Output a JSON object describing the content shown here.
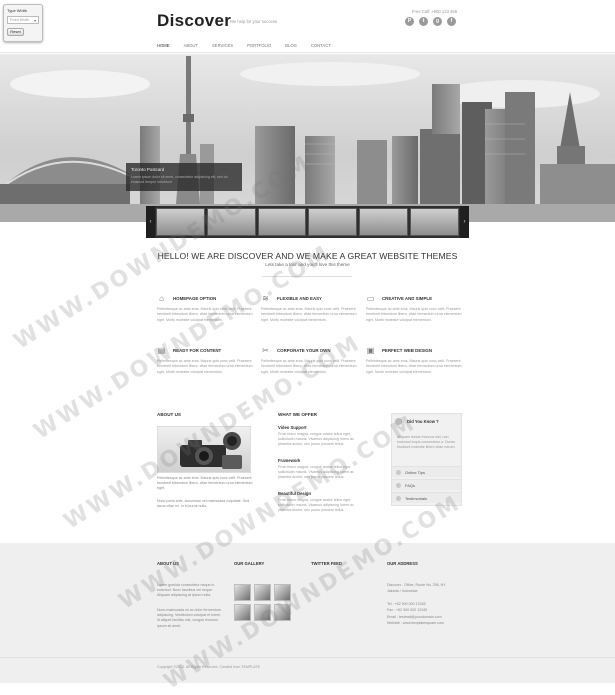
{
  "type_width": {
    "label": "Type Width",
    "select_value": "Fixed Width",
    "reset": "Reset"
  },
  "header": {
    "logo": "Discover",
    "tagline": "We help for your success",
    "free_call": "Free Call: +900 123 456",
    "social": [
      {
        "icon": "pinterest-icon",
        "glyph": "P"
      },
      {
        "icon": "twitter-icon",
        "glyph": "t"
      },
      {
        "icon": "google-plus-icon",
        "glyph": "g"
      },
      {
        "icon": "facebook-icon",
        "glyph": "f"
      }
    ]
  },
  "nav": [
    "HOME",
    "ABOUT",
    "SERVICES",
    "PORTFOLIO",
    "BLOG",
    "CONTACT"
  ],
  "hero": {
    "caption_title": "Toronto Postcard",
    "caption_text": "Lorem ipsum dolor sit amet, consectetur adipiscing elit, sed do eiusmod tempor incididunt"
  },
  "welcome": {
    "title": "HELLO! WE ARE DISCOVER AND WE MAKE A GREAT WEBSITE THEMES",
    "subtitle": "Lets take a tour and you'll love this theme"
  },
  "features": [
    {
      "icon": "home-icon",
      "glyph": "⌂",
      "title": "HOMEPAGE OPTION",
      "text": "Pellentesque ac ante eros. Mauris quis nunc velit. Praesent hendrerit bibendum libero, vitae fermentum urna elementum eget. Morbi molestie volutpat elementum."
    },
    {
      "icon": "layers-icon",
      "glyph": "≋",
      "title": "FLEXIBLE AND EASY",
      "text": "Pellentesque ac ante eros. Mauris quis nunc velit. Praesent hendrerit bibendum libero, vitae fermentum urna elementum eget. Morbi molestie volutpat elementum."
    },
    {
      "icon": "monitor-icon",
      "glyph": "▭",
      "title": "CREATIVE AND SIMPLE",
      "text": "Pellentesque ac ante eros. Mauris quis nunc velit. Praesent hendrerit bibendum libero, vitae fermentum urna elementum eget. Morbi molestie volutpat elementum."
    },
    {
      "icon": "document-icon",
      "glyph": "▤",
      "title": "READY FOR CONTENT",
      "text": "Pellentesque ac ante eros. Mauris quis nunc velit. Praesent hendrerit bibendum libero, vitae fermentum urna elementum eget. Morbi molestie volutpat elementum."
    },
    {
      "icon": "scissors-icon",
      "glyph": "✂",
      "title": "CORPORATE YOUR OWN",
      "text": "Pellentesque ac ante eros. Mauris quis nunc velit. Praesent hendrerit bibendum libero, vitae fermentum urna elementum eget. Morbi molestie volutpat elementum."
    },
    {
      "icon": "briefcase-icon",
      "glyph": "▣",
      "title": "PERFECT WEB DESIGN",
      "text": "Pellentesque ac ante eros. Mauris quis nunc velit. Praesent hendrerit bibendum libero, vitae fermentum urna elementum eget. Morbi molestie volutpat elementum."
    }
  ],
  "about": {
    "title": "ABOUT US",
    "text1": "Pellentesque ac ante eros. Mauris quis nunc velit. Praesent hendrerit bibendum libero, vitae fermentum urna elementum eget.",
    "text2": "Nunc porta ante, accumsan vel malesuada vulputate. Sed lacus vitae mi. In id purus nulla."
  },
  "offer": {
    "title": "WHAT WE OFFER",
    "items": [
      {
        "title": "Video Support",
        "text": "Proin fesco magna, congue auctor tellus eget, sollicitudin mauris. Vivamus adipiscing lorem ac pharetra auctor, nec purus posuere tellus."
      },
      {
        "title": "Framework",
        "text": "Proin fesco magna, congue auctor tellus eget, sollicitudin mauris. Vivamus adipiscing lorem ac pharetra auctor, nec purus posuere tellus."
      },
      {
        "title": "Beautiful Design",
        "text": "Proin fesco magna, congue auctor tellus eget, sollicitudin mauris. Vivamus adipiscing lorem ac pharetra auctor, nec purus posuere tellus."
      }
    ]
  },
  "did_you_know": {
    "title": "Did You Know ?",
    "text": "Aliquam lectus rhoncus nisi, non euismod turpis consectetur a. Donec tincidunt molestie libero vitae rutrum.",
    "items": [
      "Online Tips",
      "FAQs",
      "Testimonials"
    ]
  },
  "footer": {
    "about_title": "ABOUT US",
    "about_text1": "Lorem gravida consectetur neque in euismod. Nunc faucibus vel neque. Aliquam adipiscing at ipsum nulla.",
    "about_text2": "Nunc malesuada mi ac dolor fermentum adipiscing. Vestibulum volutpat et lorem, id aliquet facilisis nisi, congue rhoncus ipsum sit amet.",
    "gallery_title": "OUR GALLERY",
    "twitter_title": "TWITTER FEED",
    "address_title": "OUR ADDRESS",
    "address_lines": [
      "Discover - Office, Route No. 256, NY",
      "Jakarta / Indonesia",
      "Tel : +62 900 000 12345",
      "Fax : +62 900 000 12345",
      "Email : testmail@yourdomain.com",
      "Website : www.templatesquare.com"
    ],
    "copyright": "Copyright ©2013. All Rights Reserved. Created from TEMPLATE"
  },
  "watermark": "WWW.DOWNDEMO.COM"
}
